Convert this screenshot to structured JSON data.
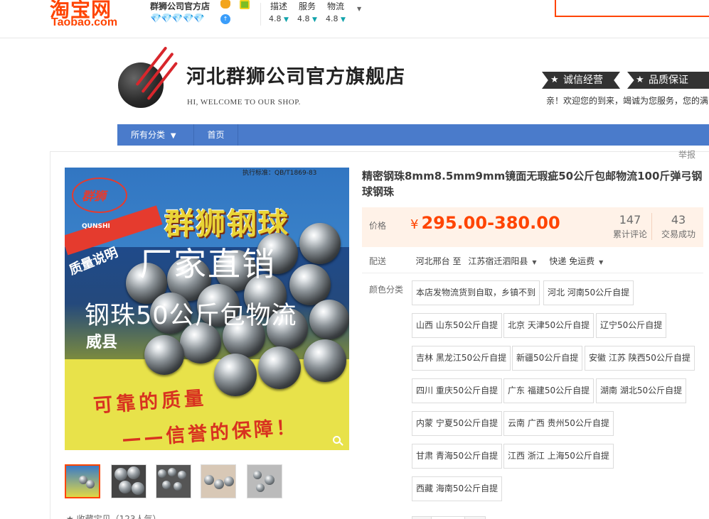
{
  "topbar": {
    "logo_cn": "淘宝网",
    "logo_en": "Taobao.com",
    "shop_name": "群狮公司官方店",
    "diamonds": "💎💎💎💎💎",
    "scores": [
      {
        "label": "描述",
        "value": "4.8"
      },
      {
        "label": "服务",
        "value": "4.8"
      },
      {
        "label": "物流",
        "value": "4.8"
      }
    ],
    "score_arrow": "▼"
  },
  "shop": {
    "title": "河北群狮公司官方旗舰店",
    "welcome_en": "HI, WELCOME TO OUR SHOP.",
    "badge_honest": "诚信经营",
    "badge_quality": "品质保证",
    "welcome_msg": "亲！欢迎您的到来，竭诚为您服务，您的满"
  },
  "nav": {
    "all_categories": "所有分类",
    "all_caret": "▼",
    "home": "首页"
  },
  "product": {
    "report": "举报",
    "title": "精密钢珠8mm8.5mm9mm镜面无瑕疵50公斤包邮物流100斤弹弓钢球钢珠",
    "image_text": {
      "standard": "执行标准：QB/T1869-83",
      "logo_cn": "群狮",
      "logo_en": "QUNSHI",
      "brand": "群狮钢球",
      "quality_note": "质量说明",
      "direct": "厂家直销",
      "shipping": "钢珠50公斤包物流",
      "weixin": "威县",
      "slogan1": "可靠的质量",
      "slogan2": "——信誉的保障！"
    },
    "thumb_count": 5,
    "favorite": "★ 收藏宝贝（123人气）",
    "price_label": "价格",
    "currency": "¥",
    "price": "295.00-380.00",
    "reviews_count": "147",
    "reviews_label": "累计评论",
    "deals_count": "43",
    "deals_label": "交易成功",
    "ship_label": "配送",
    "ship_from": "河北邢台 至",
    "ship_to": "江苏宿迁泗阳县",
    "ship_method": "快递 免运费",
    "color_label": "颜色分类",
    "options": [
      "本店发物流货到自取，乡镇不到",
      "河北 河南50公斤自提",
      "山西 山东50公斤自提",
      "北京 天津50公斤自提",
      "辽宁50公斤自提",
      "吉林 黑龙江50公斤自提",
      "新疆50公斤自提",
      "安徽 江苏 陕西50公斤自提",
      "四川 重庆50公斤自提",
      "广东 福建50公斤自提",
      "湖南 湖北50公斤自提",
      "内蒙 宁夏50公斤自提",
      "云南 广西 贵州50公斤自提",
      "甘肃 青海50公斤自提",
      "江西 浙江 上海50公斤自提",
      "西藏 海南50公斤自提"
    ]
  },
  "colors": {
    "accent": "#ff4400",
    "nav_bg": "#4a7bcb",
    "price_bg": "#fff2e8"
  }
}
